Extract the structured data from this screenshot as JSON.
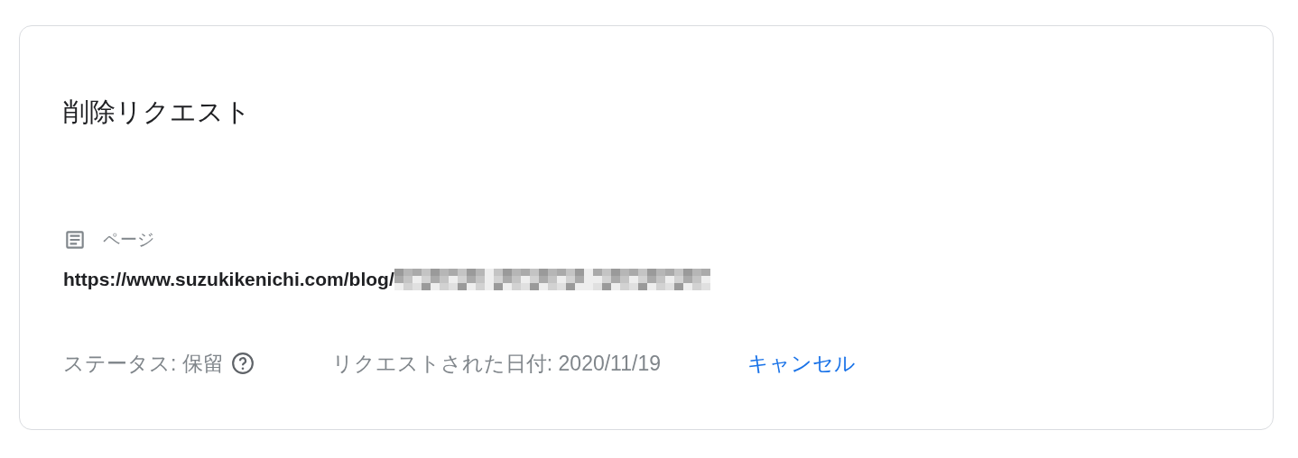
{
  "card": {
    "title": "削除リクエスト",
    "page_label": "ページ",
    "url": "https://www.suzukikenichi.com/blog/",
    "status": "ステータス: 保留",
    "requested_date": "リクエストされた日付: 2020/11/19",
    "cancel_link": "キャンセル"
  }
}
